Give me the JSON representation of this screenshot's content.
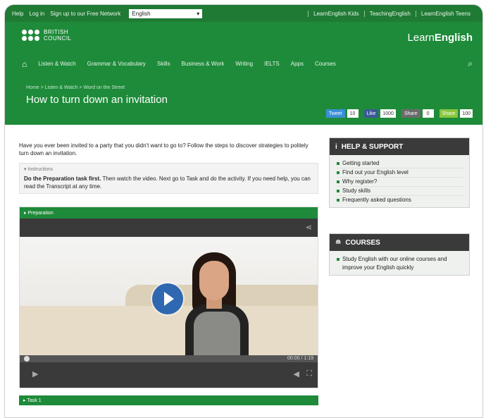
{
  "topbar": {
    "links": [
      "Help",
      "Log in",
      "Sign up to our Free Network"
    ],
    "language": "English",
    "right_links": [
      "LearnEnglish Kids",
      "TeachingEnglish",
      "LearnEnglish Teens"
    ]
  },
  "header": {
    "logo_text_1": "BRITISH",
    "logo_text_2": "COUNCIL",
    "site_name_prefix": "Learn",
    "site_name_bold": "English",
    "nav": [
      "Listen & Watch",
      "Grammar & Vocabulary",
      "Skills",
      "Business & Work",
      "Writing",
      "IELTS",
      "Apps",
      "Courses"
    ],
    "breadcrumb": "Home > Listen & Watch > Word on the Street",
    "page_title": "How to turn down an invitation",
    "shares": [
      {
        "label": "Tweet",
        "count": "10",
        "color": "#3b8fd6"
      },
      {
        "label": "Like",
        "count": "1000",
        "color": "#3b5998"
      },
      {
        "label": "Share",
        "count": "0",
        "color": "#6b6b6b"
      },
      {
        "label": "Share",
        "count": "100",
        "color": "#8ac640"
      }
    ]
  },
  "main": {
    "intro": "Have you ever been invited to a party that you didn't want to go to? Follow the steps to discover strategies to politely turn down an invitation.",
    "instructions_label": "Instructions",
    "instructions_bold": "Do the Preparation task first.",
    "instructions_text": " Then watch the video. Next go to Task and do the activity. If you need help, you can read the Transcript at any time.",
    "video_header": "Preparation",
    "video_time": "00:00 / 1:19",
    "task_bar": "Task 1"
  },
  "sidebar": {
    "help_title": "HELP & SUPPORT",
    "help_items": [
      "Getting started",
      "Find out your English level",
      "Why register?",
      "Study skills",
      "Frequently asked questions"
    ],
    "courses_title": "COURSES",
    "courses_items": [
      "Study English with our online courses and improve your English quickly"
    ]
  },
  "colors": {
    "brand_green": "#1e8b3a",
    "dark_bar": "#3a3a3a",
    "play_blue": "#2f67b0"
  }
}
